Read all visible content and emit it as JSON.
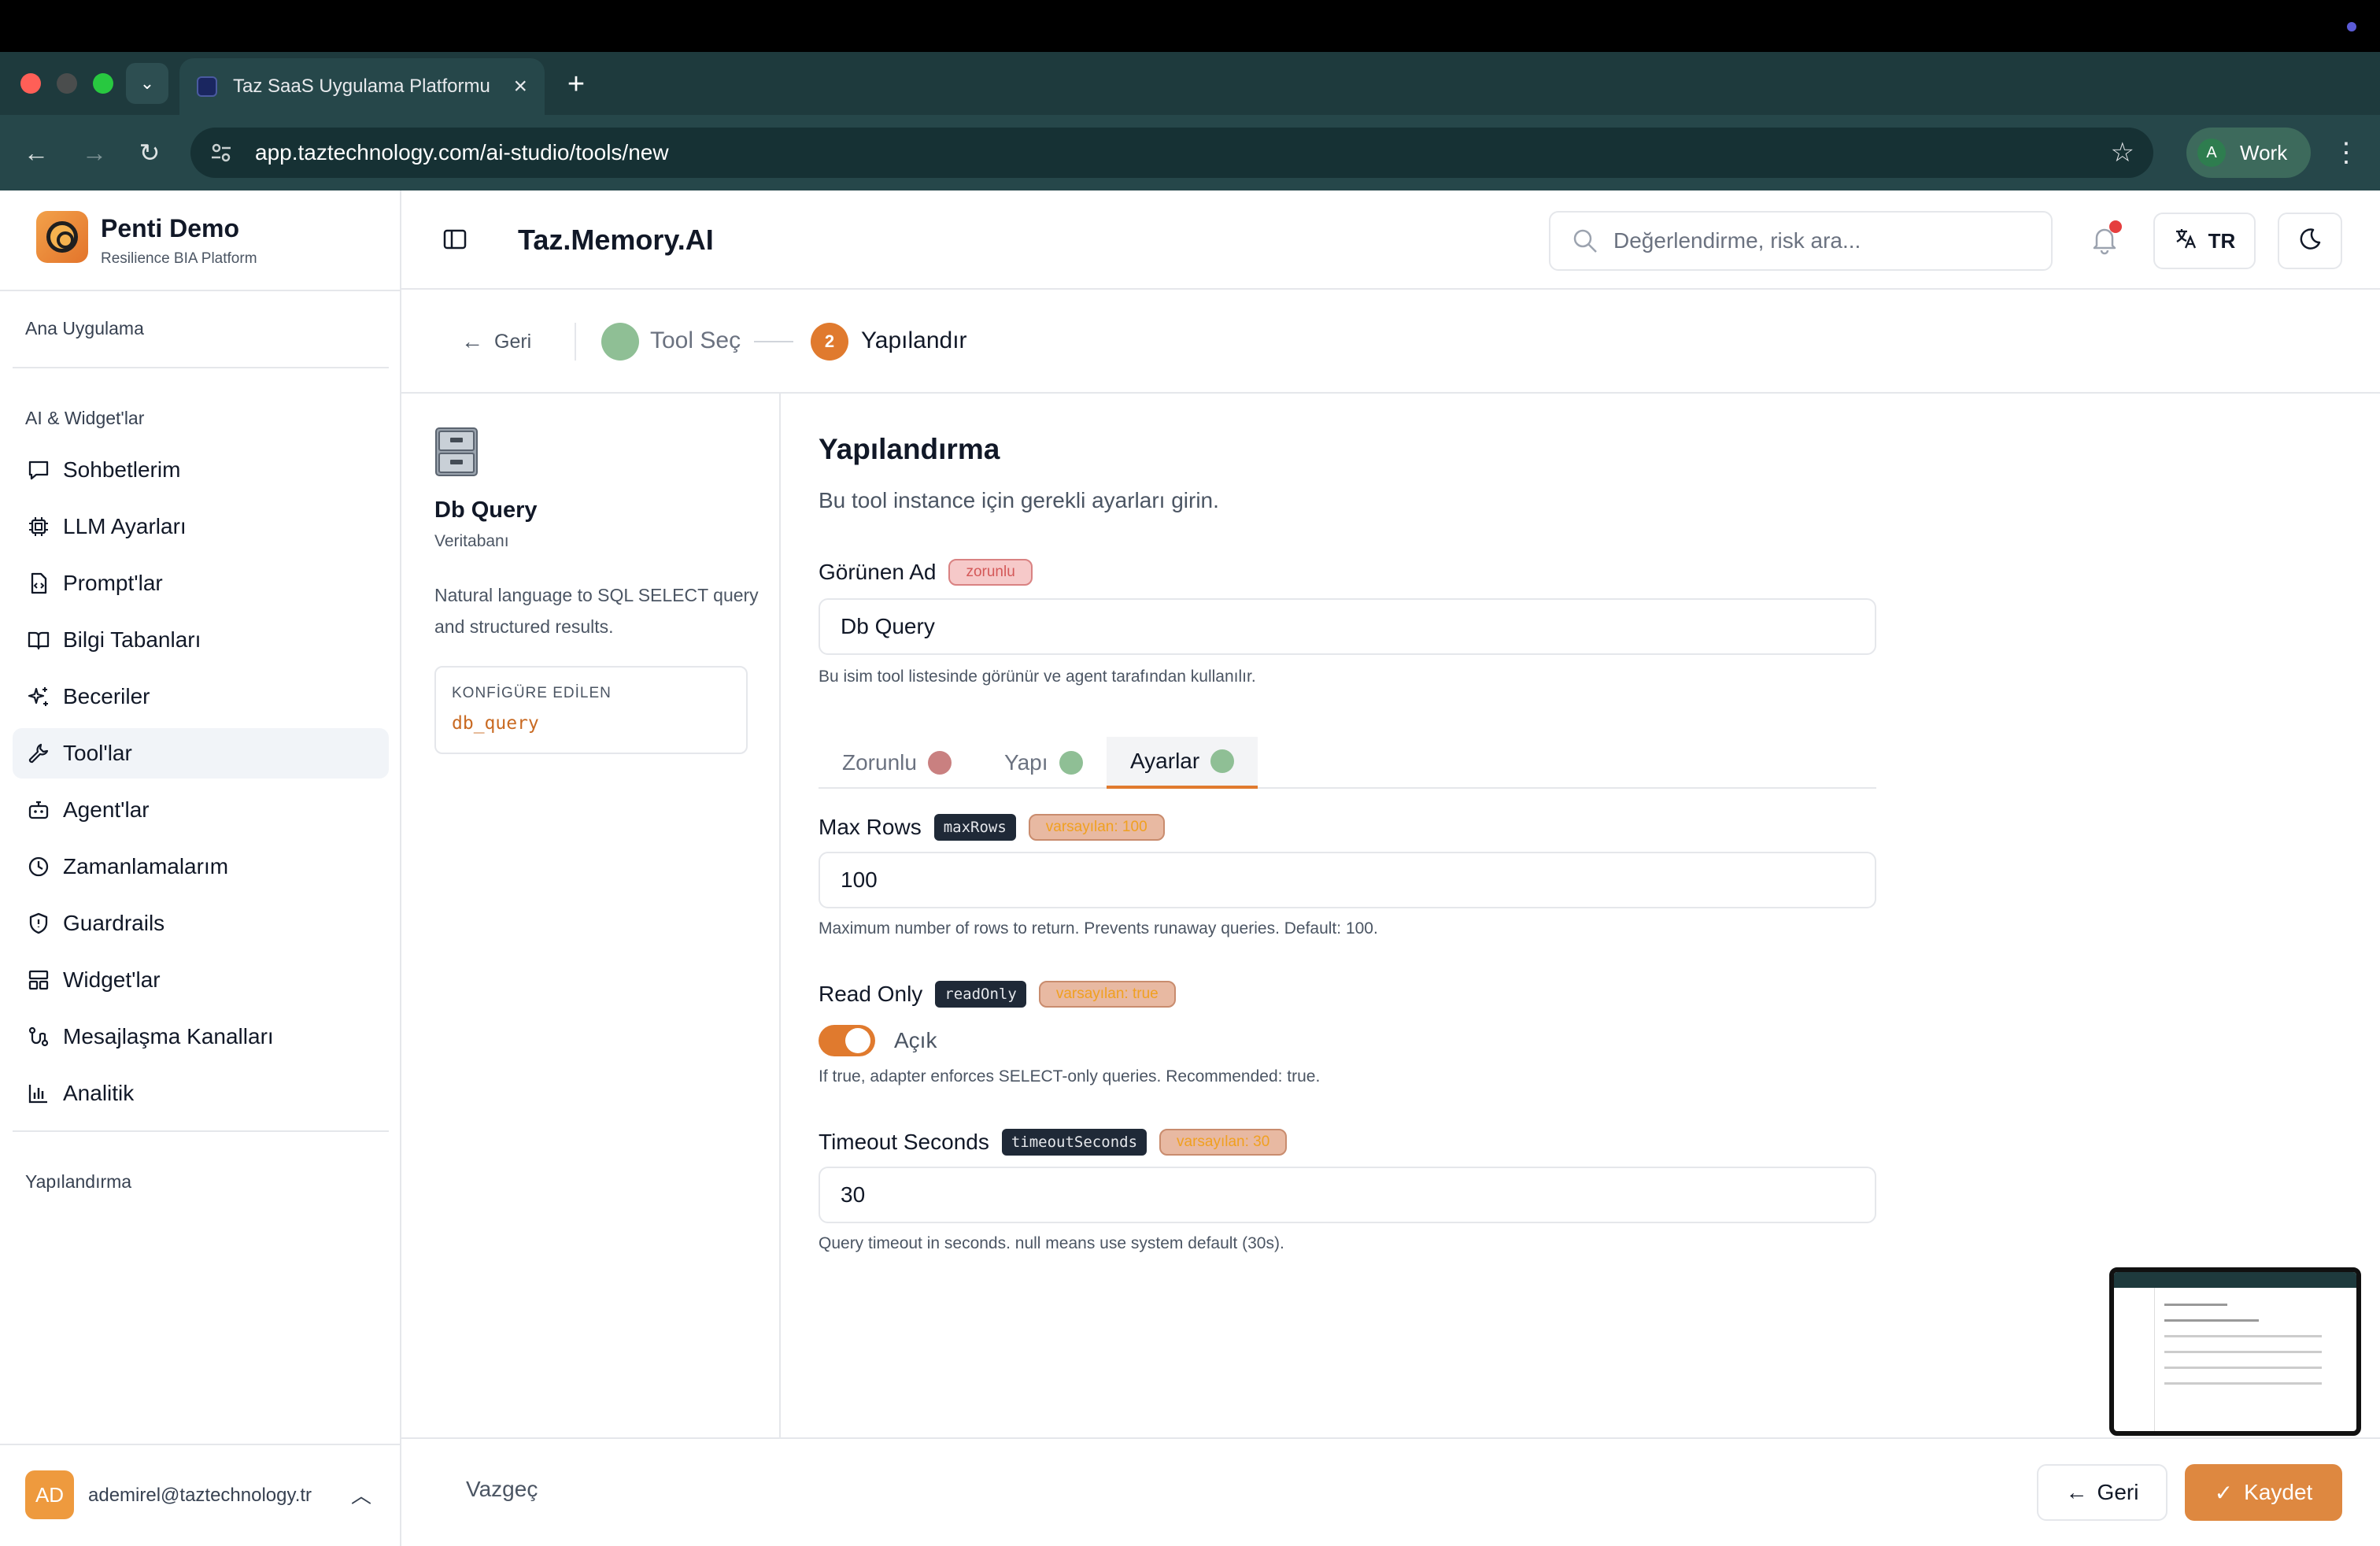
{
  "browser": {
    "tab_title": "Taz SaaS Uygulama Platformu",
    "url": "app.taztechnology.com/ai-studio/tools/new",
    "profile_initial": "A",
    "profile_name": "Work"
  },
  "sidebar": {
    "brand_name": "Penti Demo",
    "brand_subtitle": "Resilience BIA Platform",
    "section_main": "Ana Uygulama",
    "section_ai": "AI & Widget'lar",
    "section_config": "Yapılandırma",
    "items": [
      {
        "label": "Sohbetlerim",
        "icon": "chat-icon"
      },
      {
        "label": "LLM Ayarları",
        "icon": "chip-icon"
      },
      {
        "label": "Prompt'lar",
        "icon": "file-code-icon"
      },
      {
        "label": "Bilgi Tabanları",
        "icon": "book-icon"
      },
      {
        "label": "Beceriler",
        "icon": "sparkles-icon"
      },
      {
        "label": "Tool'lar",
        "icon": "wrench-icon",
        "active": true
      },
      {
        "label": "Agent'lar",
        "icon": "bot-icon"
      },
      {
        "label": "Zamanlamalarım",
        "icon": "clock-icon"
      },
      {
        "label": "Guardrails",
        "icon": "shield-icon"
      },
      {
        "label": "Widget'lar",
        "icon": "layout-icon"
      },
      {
        "label": "Mesajlaşma Kanalları",
        "icon": "route-icon"
      },
      {
        "label": "Analitik",
        "icon": "bar-chart-icon"
      }
    ],
    "user_initials": "AD",
    "user_email": "ademirel@taztechnology.tr"
  },
  "header": {
    "title": "Taz.Memory.AI",
    "search_placeholder": "Değerlendirme, risk ara...",
    "lang": "TR"
  },
  "stepper": {
    "back": "Geri",
    "step1": "Tool Seç",
    "step2_number": "2",
    "step2": "Yapılandır"
  },
  "tool": {
    "name": "Db Query",
    "category": "Veritabanı",
    "description": "Natural language to SQL SELECT query and structured results.",
    "configured_label": "KONFİGÜRE EDİLEN",
    "configured_value": "db_query"
  },
  "form": {
    "title": "Yapılandırma",
    "subtitle": "Bu tool instance için gerekli ayarları girin.",
    "display_name_label": "Görünen Ad",
    "required_badge": "zorunlu",
    "display_name_value": "Db Query",
    "display_name_help": "Bu isim tool listesinde görünür ve agent tarafından kullanılır.",
    "tabs": [
      {
        "label": "Zorunlu",
        "dot": "#c98080"
      },
      {
        "label": "Yapı",
        "dot": "#8fbf95"
      },
      {
        "label": "Ayarlar",
        "dot": "#8fbf95",
        "active": true
      }
    ],
    "max_rows": {
      "label": "Max Rows",
      "key": "maxRows",
      "default": "varsayılan: 100",
      "value": "100",
      "help": "Maximum number of rows to return. Prevents runaway queries. Default: 100."
    },
    "read_only": {
      "label": "Read Only",
      "key": "readOnly",
      "default": "varsayılan: true",
      "state": "Açık",
      "enabled": true,
      "help": "If true, adapter enforces SELECT-only queries. Recommended: true."
    },
    "timeout": {
      "label": "Timeout Seconds",
      "key": "timeoutSeconds",
      "default": "varsayılan: 30",
      "value": "30",
      "help": "Query timeout in seconds. null means use system default (30s)."
    }
  },
  "footer": {
    "cancel": "Vazgeç",
    "back": "Geri",
    "save": "Kaydet"
  },
  "colors": {
    "accent": "#e07a2e",
    "browser_chrome": "#26474a"
  }
}
